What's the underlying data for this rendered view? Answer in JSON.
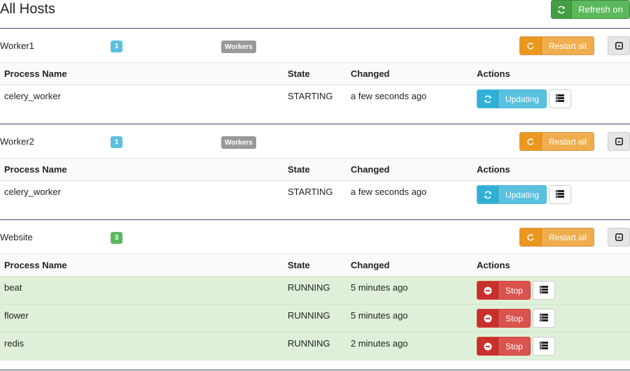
{
  "page": {
    "title": "All Hosts",
    "refresh_label": "Refresh on"
  },
  "table_headers": {
    "name": "Process Name",
    "state": "State",
    "changed": "Changed",
    "actions": "Actions"
  },
  "hosts": [
    {
      "name": "Worker1",
      "count": "1",
      "count_style": "info",
      "group": "Workers",
      "restart_label": "Restart all",
      "processes": [
        {
          "name": "celery_worker",
          "state": "STARTING",
          "changed": "a few seconds ago",
          "action_label": "Updating",
          "action_style": "info"
        }
      ]
    },
    {
      "name": "Worker2",
      "count": "1",
      "count_style": "info",
      "group": "Workers",
      "restart_label": "Restart all",
      "processes": [
        {
          "name": "celery_worker",
          "state": "STARTING",
          "changed": "a few seconds ago",
          "action_label": "Updating",
          "action_style": "info"
        }
      ]
    },
    {
      "name": "Website",
      "count": "3",
      "count_style": "success",
      "group": "",
      "restart_label": "Restart all",
      "processes": [
        {
          "name": "beat",
          "state": "RUNNING",
          "changed": "5 minutes ago",
          "action_label": "Stop",
          "action_style": "danger"
        },
        {
          "name": "flower",
          "state": "RUNNING",
          "changed": "5 minutes ago",
          "action_label": "Stop",
          "action_style": "danger"
        },
        {
          "name": "redis",
          "state": "RUNNING",
          "changed": "2 minutes ago",
          "action_label": "Stop",
          "action_style": "danger"
        }
      ]
    }
  ],
  "colors": {
    "success": "#5cb85c",
    "info": "#5bc0de",
    "warning": "#f0ad4e",
    "danger": "#d9534f",
    "running_row": "#dff0d8"
  },
  "icons": {
    "refresh": "refresh-icon",
    "restart": "restart-icon",
    "collapse": "collapse-icon",
    "log": "log-icon",
    "stop": "stop-icon"
  }
}
